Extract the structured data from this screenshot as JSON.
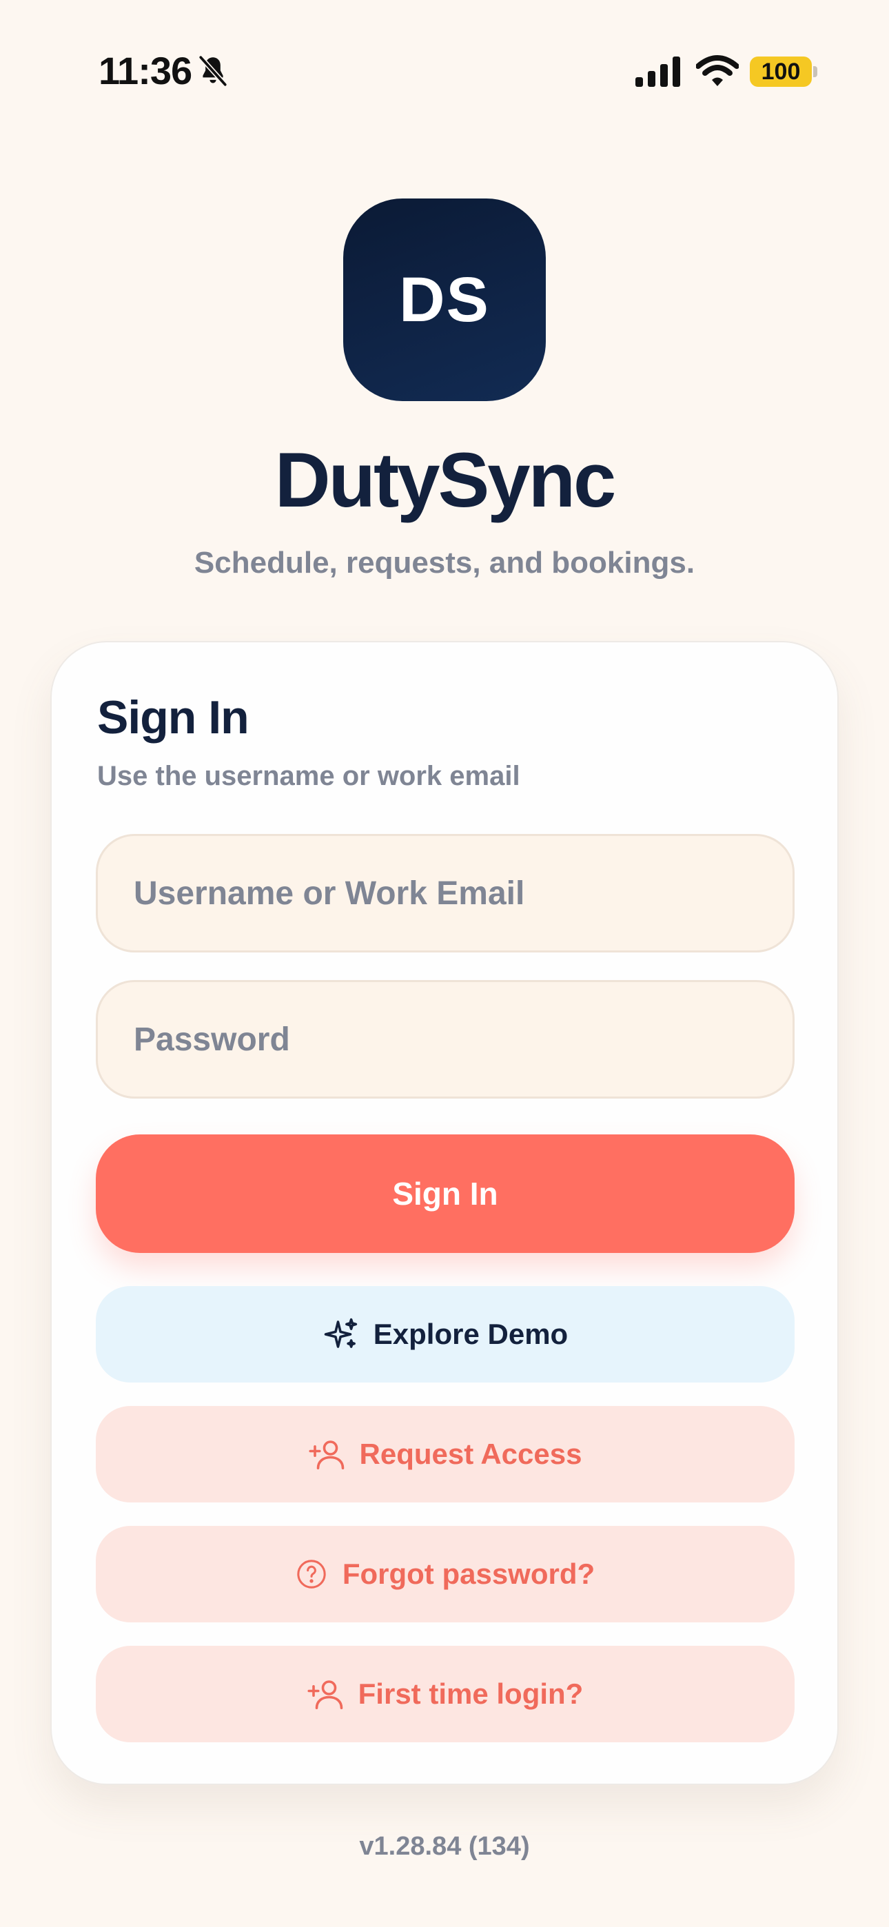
{
  "status_bar": {
    "time": "11:36",
    "battery": "100",
    "icons": [
      "bell-slash-icon",
      "cellular-signal-icon",
      "wifi-icon",
      "battery-icon"
    ]
  },
  "header": {
    "logo_text": "DS",
    "app_name": "DutySync",
    "tagline": "Schedule, requests, and bookings."
  },
  "signin_card": {
    "title": "Sign In",
    "subtitle": "Use the username or work email",
    "username_placeholder": "Username or Work Email",
    "username_value": "",
    "password_placeholder": "Password",
    "password_value": "",
    "signin_label": "Sign In",
    "demo_label": "Explore Demo",
    "request_access_label": "Request Access",
    "forgot_password_label": "Forgot password?",
    "first_time_label": "First time login?"
  },
  "footer": {
    "version": "v1.28.84 (134)"
  },
  "colors": {
    "background": "#fdf7f1",
    "navy": "#13213d",
    "coral": "#ff6f61",
    "coral_text": "#f06a5b",
    "demo_bg": "#e6f4fc",
    "soft_bg": "#fde6e1",
    "field_bg": "#fdf4ea",
    "muted": "#7f8594"
  }
}
